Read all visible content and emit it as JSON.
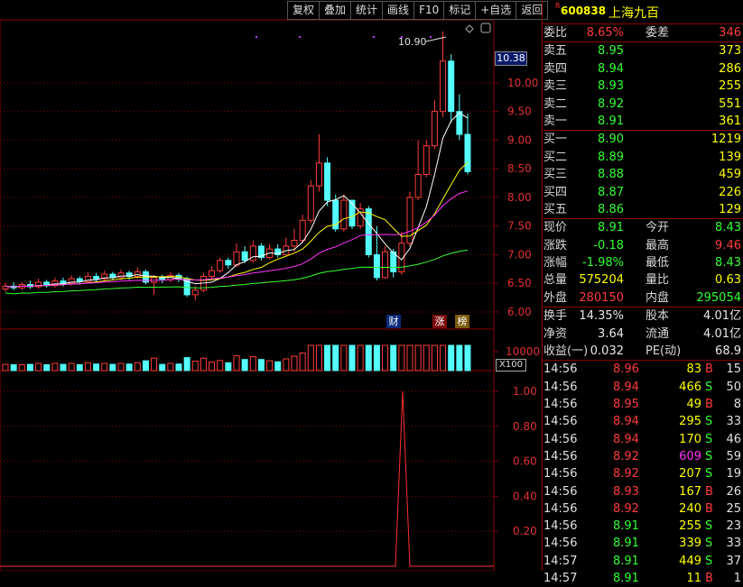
{
  "toolbar": [
    "复权",
    "叠加",
    "统计",
    "画线",
    "F10",
    "标记",
    "+自选",
    "返回"
  ],
  "stock": {
    "r_mark": "R",
    "code": "600838",
    "name": "上海九百"
  },
  "chart": {
    "y_labels": [
      "10.00",
      "9.50",
      "9.00",
      "8.50",
      "8.00",
      "7.50",
      "7.00",
      "6.50",
      "6.00"
    ],
    "price_tag": "10.38",
    "high_label": "10.90",
    "badges": [
      "财",
      "涨",
      "榜"
    ],
    "vol_label": "10000",
    "vol_unit": "X100",
    "ind_labels": [
      "1.00",
      "0.80",
      "0.60",
      "0.40",
      "0.20"
    ],
    "colors": {
      "up": "#ff3c3c",
      "down": "#54fcfc",
      "ma5": "#ffffff",
      "ma10": "#ffff00",
      "ma20": "#ff33ff",
      "ma60": "#33ff33",
      "grid": "#8b0000"
    }
  },
  "quote": {
    "weibi": {
      "label": "委比",
      "value": "8.65%",
      "label2": "委差",
      "value2": "346"
    },
    "sell": [
      {
        "label": "卖五",
        "price": "8.95",
        "qty": "373"
      },
      {
        "label": "卖四",
        "price": "8.94",
        "qty": "286"
      },
      {
        "label": "卖三",
        "price": "8.93",
        "qty": "255"
      },
      {
        "label": "卖二",
        "price": "8.92",
        "qty": "551"
      },
      {
        "label": "卖一",
        "price": "8.91",
        "qty": "361"
      }
    ],
    "buy": [
      {
        "label": "买一",
        "price": "8.90",
        "qty": "1219"
      },
      {
        "label": "买二",
        "price": "8.89",
        "qty": "139"
      },
      {
        "label": "买三",
        "price": "8.88",
        "qty": "459"
      },
      {
        "label": "买四",
        "price": "8.87",
        "qty": "226"
      },
      {
        "label": "买五",
        "price": "8.86",
        "qty": "129"
      }
    ],
    "stats1": [
      {
        "l": "现价",
        "v": "8.91",
        "vc": "green",
        "l2": "今开",
        "v2": "8.43",
        "v2c": "green"
      },
      {
        "l": "涨跌",
        "v": "-0.18",
        "vc": "green",
        "l2": "最高",
        "v2": "9.46",
        "v2c": "red"
      },
      {
        "l": "涨幅",
        "v": "-1.98%",
        "vc": "green",
        "l2": "最低",
        "v2": "8.43",
        "v2c": "green"
      },
      {
        "l": "总量",
        "v": "575204",
        "vc": "yellow",
        "l2": "量比",
        "v2": "0.63",
        "v2c": "yellow"
      },
      {
        "l": "外盘",
        "v": "280150",
        "vc": "red",
        "l2": "内盘",
        "v2": "295054",
        "v2c": "green"
      }
    ],
    "stats2": [
      {
        "l": "换手",
        "v": "14.35%",
        "vc": "white",
        "l2": "股本",
        "v2": "4.01亿",
        "v2c": "white"
      },
      {
        "l": "净资",
        "v": "3.64",
        "vc": "white",
        "l2": "流通",
        "v2": "4.01亿",
        "v2c": "white"
      },
      {
        "l": "收益(一)",
        "v": "0.032",
        "vc": "white",
        "l2": "PE(动)",
        "v2": "68.9",
        "v2c": "white"
      }
    ]
  },
  "ticks": [
    {
      "t": "14:56",
      "p": "8.96",
      "v": "83",
      "bs": "B",
      "n": "15",
      "vc": "yellow"
    },
    {
      "t": "14:56",
      "p": "8.94",
      "v": "466",
      "bs": "S",
      "n": "50",
      "vc": "yellow"
    },
    {
      "t": "14:56",
      "p": "8.95",
      "v": "49",
      "bs": "B",
      "n": "8",
      "vc": "yellow"
    },
    {
      "t": "14:56",
      "p": "8.94",
      "v": "295",
      "bs": "S",
      "n": "33",
      "vc": "yellow"
    },
    {
      "t": "14:56",
      "p": "8.94",
      "v": "170",
      "bs": "S",
      "n": "46",
      "vc": "yellow"
    },
    {
      "t": "14:56",
      "p": "8.92",
      "v": "609",
      "bs": "S",
      "n": "59",
      "vc": "magenta"
    },
    {
      "t": "14:56",
      "p": "8.92",
      "v": "207",
      "bs": "S",
      "n": "19",
      "vc": "yellow"
    },
    {
      "t": "14:56",
      "p": "8.93",
      "v": "167",
      "bs": "B",
      "n": "26",
      "vc": "yellow"
    },
    {
      "t": "14:56",
      "p": "8.92",
      "v": "240",
      "bs": "B",
      "n": "25",
      "vc": "yellow"
    },
    {
      "t": "14:56",
      "p": "8.91",
      "v": "255",
      "bs": "S",
      "n": "23",
      "vc": "yellow"
    },
    {
      "t": "14:56",
      "p": "8.91",
      "v": "339",
      "bs": "S",
      "n": "33",
      "vc": "yellow"
    },
    {
      "t": "14:57",
      "p": "8.91",
      "v": "449",
      "bs": "S",
      "n": "37",
      "vc": "yellow"
    },
    {
      "t": "14:57",
      "p": "8.91",
      "v": "11",
      "bs": "B",
      "n": "1",
      "vc": "yellow"
    }
  ],
  "chart_data": {
    "type": "candlestick",
    "y_range": [
      5.7,
      11.1
    ],
    "candles": [
      [
        6.4,
        6.45,
        6.35,
        6.5
      ],
      [
        6.45,
        6.42,
        6.38,
        6.52
      ],
      [
        6.42,
        6.48,
        6.38,
        6.52
      ],
      [
        6.48,
        6.44,
        6.4,
        6.55
      ],
      [
        6.44,
        6.52,
        6.4,
        6.58
      ],
      [
        6.52,
        6.46,
        6.42,
        6.56
      ],
      [
        6.46,
        6.54,
        6.42,
        6.6
      ],
      [
        6.54,
        6.5,
        6.45,
        6.6
      ],
      [
        6.5,
        6.58,
        6.46,
        6.64
      ],
      [
        6.58,
        6.53,
        6.48,
        6.62
      ],
      [
        6.53,
        6.62,
        6.5,
        6.7
      ],
      [
        6.62,
        6.58,
        6.52,
        6.68
      ],
      [
        6.58,
        6.66,
        6.54,
        6.72
      ],
      [
        6.66,
        6.6,
        6.55,
        6.7
      ],
      [
        6.6,
        6.68,
        6.56,
        6.74
      ],
      [
        6.68,
        6.62,
        6.56,
        6.72
      ],
      [
        6.62,
        6.7,
        6.58,
        6.78
      ],
      [
        6.7,
        6.52,
        6.48,
        6.74
      ],
      [
        6.52,
        6.6,
        6.3,
        6.64
      ],
      [
        6.6,
        6.56,
        6.5,
        6.65
      ],
      [
        6.56,
        6.64,
        6.52,
        6.7
      ],
      [
        6.64,
        6.58,
        6.52,
        6.68
      ],
      [
        6.58,
        6.3,
        6.26,
        6.62
      ],
      [
        6.3,
        6.38,
        6.2,
        6.45
      ],
      [
        6.38,
        6.62,
        6.34,
        6.68
      ],
      [
        6.62,
        6.72,
        6.58,
        6.8
      ],
      [
        6.72,
        6.9,
        6.68,
        6.95
      ],
      [
        6.9,
        6.82,
        6.75,
        6.95
      ],
      [
        6.82,
        7.05,
        6.78,
        7.2
      ],
      [
        7.05,
        6.9,
        6.85,
        7.15
      ],
      [
        6.9,
        7.15,
        6.86,
        7.25
      ],
      [
        7.15,
        6.95,
        6.9,
        7.2
      ],
      [
        6.95,
        7.1,
        6.92,
        7.18
      ],
      [
        7.1,
        7.0,
        6.95,
        7.18
      ],
      [
        7.0,
        7.15,
        6.98,
        7.3
      ],
      [
        7.15,
        7.25,
        7.05,
        7.45
      ],
      [
        7.25,
        7.6,
        7.2,
        7.7
      ],
      [
        7.6,
        8.2,
        7.55,
        8.3
      ],
      [
        8.2,
        8.6,
        8.1,
        9.1
      ],
      [
        8.6,
        7.95,
        7.85,
        8.7
      ],
      [
        7.95,
        7.45,
        7.4,
        8.05
      ],
      [
        7.45,
        7.95,
        7.4,
        8.05
      ],
      [
        7.95,
        7.5,
        7.45,
        7.95
      ],
      [
        7.5,
        7.8,
        7.45,
        7.9
      ],
      [
        7.8,
        7.0,
        6.95,
        7.85
      ],
      [
        7.0,
        6.6,
        6.55,
        7.5
      ],
      [
        6.6,
        7.05,
        6.58,
        7.15
      ],
      [
        7.05,
        6.7,
        6.6,
        7.1
      ],
      [
        6.7,
        7.2,
        6.65,
        7.4
      ],
      [
        7.2,
        8.0,
        7.15,
        8.1
      ],
      [
        8.0,
        8.4,
        7.95,
        9.0
      ],
      [
        8.4,
        8.9,
        8.35,
        9.0
      ],
      [
        8.9,
        9.5,
        8.85,
        9.7
      ],
      [
        9.5,
        10.38,
        9.4,
        10.9
      ],
      [
        10.38,
        9.5,
        9.3,
        10.5
      ],
      [
        9.5,
        9.1,
        9.0,
        9.8
      ],
      [
        9.1,
        8.45,
        8.4,
        9.46
      ]
    ],
    "vol_max": 1.2
  },
  "indicator": {
    "type": "line",
    "peak_index": 55
  }
}
